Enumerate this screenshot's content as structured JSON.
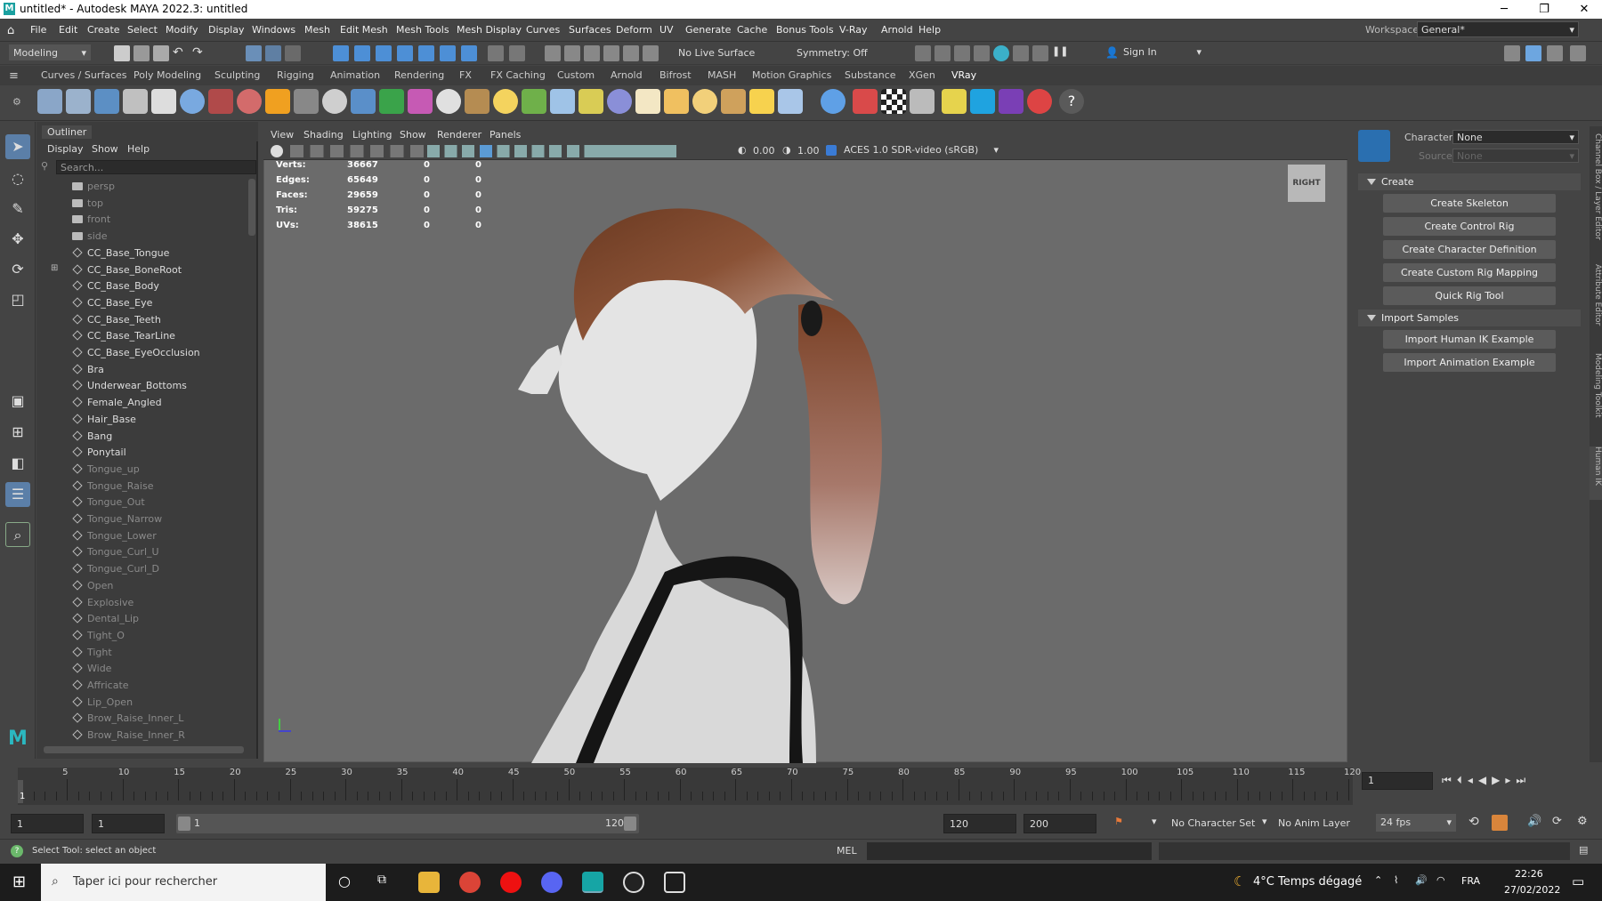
{
  "window": {
    "title": "untitled* - Autodesk MAYA 2022.3: untitled",
    "app_icon": "M"
  },
  "menubar": {
    "items": [
      "File",
      "Edit",
      "Create",
      "Select",
      "Modify",
      "Display",
      "Windows",
      "Mesh",
      "Edit Mesh",
      "Mesh Tools",
      "Mesh Display",
      "Curves",
      "Surfaces",
      "Deform",
      "UV",
      "Generate",
      "Cache",
      "Bonus Tools",
      "V-Ray",
      "Arnold",
      "Help"
    ],
    "workspace_label": "Workspace:",
    "workspace_value": "General*"
  },
  "statusline": {
    "menuset": "Modeling",
    "live_surface": "No Live Surface",
    "symmetry": "Symmetry: Off",
    "sign_in": "Sign In"
  },
  "shelf": {
    "tabs": [
      "Curves / Surfaces",
      "Poly Modeling",
      "Sculpting",
      "Rigging",
      "Animation",
      "Rendering",
      "FX",
      "FX Caching",
      "Custom",
      "Arnold",
      "Bifrost",
      "MASH",
      "Motion Graphics",
      "Substance",
      "XGen",
      "VRay"
    ],
    "active_tab": "VRay"
  },
  "outliner": {
    "title": "Outliner",
    "menu": [
      "Display",
      "Show",
      "Help"
    ],
    "search_placeholder": "Search...",
    "items": [
      {
        "label": "persp",
        "type": "camera",
        "dim": true
      },
      {
        "label": "top",
        "type": "camera",
        "dim": true
      },
      {
        "label": "front",
        "type": "camera",
        "dim": true
      },
      {
        "label": "side",
        "type": "camera",
        "dim": true
      },
      {
        "label": "CC_Base_Tongue",
        "type": "mesh",
        "dim": false
      },
      {
        "label": "CC_Base_BoneRoot",
        "type": "joint",
        "dim": false
      },
      {
        "label": "CC_Base_Body",
        "type": "mesh",
        "dim": false
      },
      {
        "label": "CC_Base_Eye",
        "type": "mesh",
        "dim": false
      },
      {
        "label": "CC_Base_Teeth",
        "type": "mesh",
        "dim": false
      },
      {
        "label": "CC_Base_TearLine",
        "type": "mesh",
        "dim": false
      },
      {
        "label": "CC_Base_EyeOcclusion",
        "type": "mesh",
        "dim": false
      },
      {
        "label": "Bra",
        "type": "mesh",
        "dim": false
      },
      {
        "label": "Underwear_Bottoms",
        "type": "mesh",
        "dim": false
      },
      {
        "label": "Female_Angled",
        "type": "mesh",
        "dim": false
      },
      {
        "label": "Hair_Base",
        "type": "mesh",
        "dim": false
      },
      {
        "label": "Bang",
        "type": "mesh",
        "dim": false
      },
      {
        "label": "Ponytail",
        "type": "mesh",
        "dim": false
      },
      {
        "label": "Tongue_up",
        "type": "mesh",
        "dim": true
      },
      {
        "label": "Tongue_Raise",
        "type": "mesh",
        "dim": true
      },
      {
        "label": "Tongue_Out",
        "type": "mesh",
        "dim": true
      },
      {
        "label": "Tongue_Narrow",
        "type": "mesh",
        "dim": true
      },
      {
        "label": "Tongue_Lower",
        "type": "mesh",
        "dim": true
      },
      {
        "label": "Tongue_Curl_U",
        "type": "mesh",
        "dim": true
      },
      {
        "label": "Tongue_Curl_D",
        "type": "mesh",
        "dim": true
      },
      {
        "label": "Open",
        "type": "mesh",
        "dim": true
      },
      {
        "label": "Explosive",
        "type": "mesh",
        "dim": true
      },
      {
        "label": "Dental_Lip",
        "type": "mesh",
        "dim": true
      },
      {
        "label": "Tight_O",
        "type": "mesh",
        "dim": true
      },
      {
        "label": "Tight",
        "type": "mesh",
        "dim": true
      },
      {
        "label": "Wide",
        "type": "mesh",
        "dim": true
      },
      {
        "label": "Affricate",
        "type": "mesh",
        "dim": true
      },
      {
        "label": "Lip_Open",
        "type": "mesh",
        "dim": true
      },
      {
        "label": "Brow_Raise_Inner_L",
        "type": "mesh",
        "dim": true
      },
      {
        "label": "Brow_Raise_Inner_R",
        "type": "mesh",
        "dim": true
      }
    ]
  },
  "viewport": {
    "menu": [
      "View",
      "Shading",
      "Lighting",
      "Show",
      "Renderer",
      "Panels"
    ],
    "exposure": "0.00",
    "gamma": "1.00",
    "color_transform": "ACES 1.0 SDR-video (sRGB)",
    "view_cube": "RIGHT",
    "hud": {
      "rows": [
        {
          "label": "Verts:",
          "a": "36667",
          "b": "0",
          "c": "0"
        },
        {
          "label": "Edges:",
          "a": "65649",
          "b": "0",
          "c": "0"
        },
        {
          "label": "Faces:",
          "a": "29659",
          "b": "0",
          "c": "0"
        },
        {
          "label": "Tris:",
          "a": "59275",
          "b": "0",
          "c": "0"
        },
        {
          "label": "UVs:",
          "a": "38615",
          "b": "0",
          "c": "0"
        }
      ]
    }
  },
  "humanik": {
    "character_label": "Character:",
    "character_value": "None",
    "source_label": "Source:",
    "source_value": "None",
    "create_section": "Create",
    "create_buttons": [
      "Create Skeleton",
      "Create Control Rig",
      "Create Character Definition",
      "Create Custom Rig Mapping",
      "Quick Rig Tool"
    ],
    "import_section": "Import Samples",
    "import_buttons": [
      "Import Human IK Example",
      "Import Animation Example"
    ]
  },
  "side_tabs": [
    "Channel Box / Layer Editor",
    "Attribute Editor",
    "Modeling Toolkit",
    "Human IK"
  ],
  "timeline": {
    "labels": [
      "5",
      "10",
      "15",
      "20",
      "25",
      "30",
      "35",
      "40",
      "45",
      "50",
      "55",
      "60",
      "65",
      "70",
      "75",
      "80",
      "85",
      "90",
      "95",
      "100",
      "105",
      "110",
      "115",
      "120"
    ],
    "current_frame_marker": "1",
    "current_frame_field": "1"
  },
  "range": {
    "start": "1",
    "playback_start": "1",
    "slider_start": "1",
    "slider_end": "120",
    "playback_end": "120",
    "end": "200",
    "character_set": "No Character Set",
    "anim_layer": "No Anim Layer",
    "fps": "24 fps"
  },
  "helpline": {
    "text": "Select Tool: select an object",
    "mel": "MEL"
  },
  "taskbar": {
    "search_placeholder": "Taper ici pour rechercher",
    "weather": "4°C  Temps dégagé",
    "lang": "FRA",
    "time": "22:26",
    "date": "27/02/2022"
  }
}
